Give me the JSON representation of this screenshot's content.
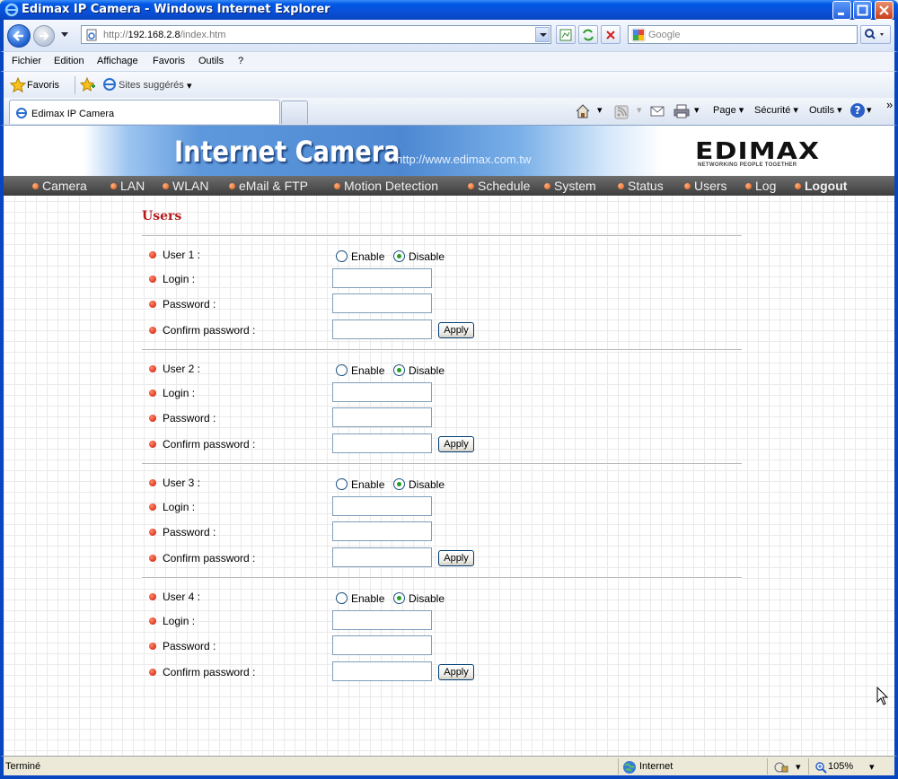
{
  "window": {
    "title": "Edimax IP Camera - Windows Internet Explorer"
  },
  "address": {
    "url_prefix": "http://",
    "url_host": "192.168.2.8",
    "url_path": "/index.htm",
    "search_placeholder": "Google"
  },
  "menu": [
    "Fichier",
    "Edition",
    "Affichage",
    "Favoris",
    "Outils",
    "?"
  ],
  "favorites": {
    "label": "Favoris",
    "suggested": "Sites suggérés"
  },
  "tab": {
    "label": "Edimax IP Camera"
  },
  "commands": {
    "page": "Page",
    "security": "Sécurité",
    "tools": "Outils"
  },
  "banner": {
    "brand": "Internet Camera",
    "url": "http://www.edimax.com.tw",
    "logo": "EDIMAX",
    "tagline": "NETWORKING PEOPLE TOGETHER"
  },
  "nav": [
    "Camera",
    "LAN",
    "WLAN",
    "eMail & FTP",
    "Motion Detection",
    "Schedule",
    "System",
    "Status",
    "Users",
    "Log",
    "Logout"
  ],
  "page": {
    "heading": "Users",
    "enable_label": "Enable",
    "disable_label": "Disable",
    "login_label": "Login :",
    "password_label": "Password :",
    "confirm_label": "Confirm password :",
    "apply_label": "Apply",
    "users": [
      {
        "label": "User 1 :",
        "state": "Disable",
        "login": "",
        "password": "",
        "confirm": ""
      },
      {
        "label": "User 2 :",
        "state": "Disable",
        "login": "",
        "password": "",
        "confirm": ""
      },
      {
        "label": "User 3 :",
        "state": "Disable",
        "login": "",
        "password": "",
        "confirm": ""
      },
      {
        "label": "User 4 :",
        "state": "Disable",
        "login": "",
        "password": "",
        "confirm": ""
      }
    ]
  },
  "status": {
    "text": "Terminé",
    "zone": "Internet",
    "zoom": "105%"
  },
  "colors": {
    "heading": "#b31b1b",
    "titlebar": "#0a50d8",
    "bullet": "#cc1100"
  }
}
